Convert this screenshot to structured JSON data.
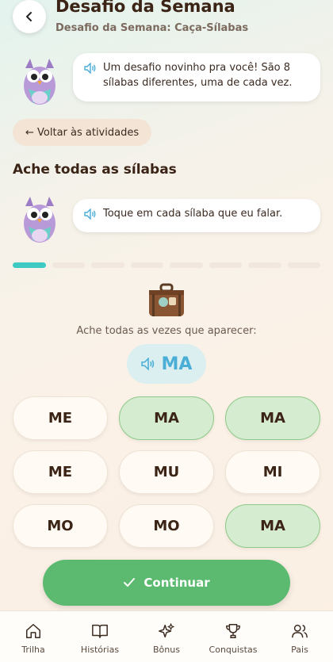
{
  "header": {
    "title": "Desafio da Semana",
    "subtitle": "Desafio da Semana: Caça-Sílabas"
  },
  "bubbles": {
    "intro": "Um desafio novinho pra você! São 8 sílabas diferentes, uma de cada vez.",
    "instruction": "Toque em cada sílaba que eu falar."
  },
  "back_activities_label": "← Voltar às atividades",
  "section_title": "Ache todas as sílabas",
  "progress": {
    "current": 1,
    "total": 8
  },
  "prompt": {
    "text": "Ache todas as vezes que aparecer:",
    "target": "MA"
  },
  "syllables": [
    {
      "text": "ME",
      "found": false
    },
    {
      "text": "MA",
      "found": true
    },
    {
      "text": "MA",
      "found": true
    },
    {
      "text": "ME",
      "found": false
    },
    {
      "text": "MU",
      "found": false
    },
    {
      "text": "MI",
      "found": false
    },
    {
      "text": "MO",
      "found": false
    },
    {
      "text": "MO",
      "found": false
    },
    {
      "text": "MA",
      "found": true
    }
  ],
  "continue_label": "Continuar",
  "tabs": [
    {
      "label": "Trilha",
      "icon": "home-icon"
    },
    {
      "label": "Histórias",
      "icon": "book-icon"
    },
    {
      "label": "Bônus",
      "icon": "sparkle-icon"
    },
    {
      "label": "Conquistas",
      "icon": "trophy-icon"
    },
    {
      "label": "Pais",
      "icon": "users-icon"
    }
  ],
  "colors": {
    "accent_teal": "#3ec9c2",
    "continue_green": "#5cba70",
    "found_green": "#d5ecd0",
    "target_blue": "#4aaed6"
  }
}
